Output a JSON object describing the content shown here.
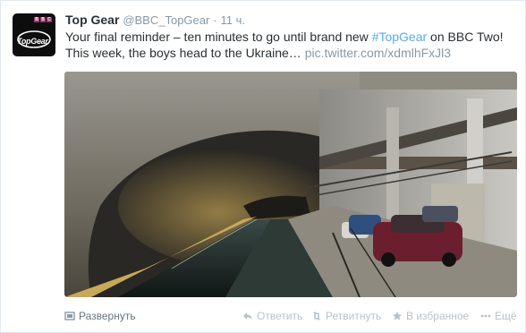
{
  "tweet": {
    "name": "Top Gear",
    "handle": "@BBC_TopGear",
    "separator": "·",
    "time": "11 ч.",
    "text_before": "Your final reminder – ten minutes to go until brand new ",
    "hashtag": "#TopGear",
    "text_after": " on BBC Two! This week, the boys head to the Ukraine…",
    "pic_url": "pic.twitter.com/xdmlhFxJl3",
    "avatar": {
      "bbc_letters": [
        "B",
        "B",
        "C"
      ],
      "logo_text": "TopGear"
    }
  },
  "actions": {
    "expand": "Развернуть",
    "reply": "Ответить",
    "retweet": "Ретвитнуть",
    "favorite": "В избранное",
    "more": "Ещё"
  },
  "colors": {
    "link": "#55acee",
    "muted": "#8899a6",
    "action": "#b9c2c9"
  },
  "icons": {
    "expand": "media-expand-icon",
    "reply": "reply-arrow-icon",
    "retweet": "retweet-icon",
    "favorite": "star-icon",
    "more": "ellipsis-icon"
  }
}
